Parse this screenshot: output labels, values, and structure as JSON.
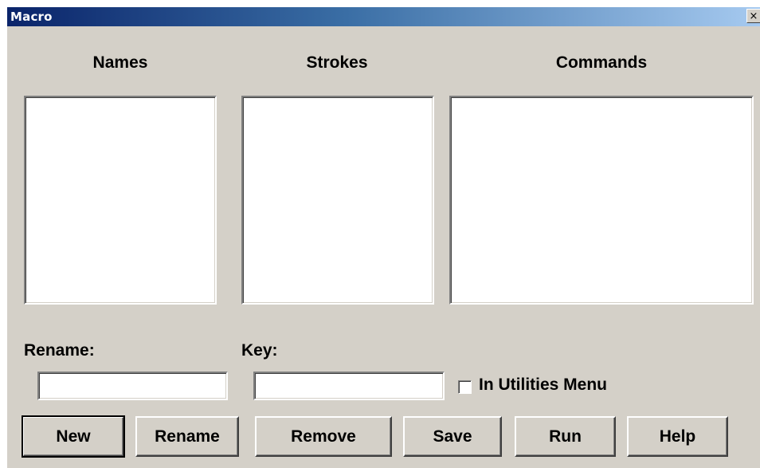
{
  "window": {
    "title": "Macro",
    "close_glyph": "×"
  },
  "columns": {
    "names_label": "Names",
    "strokes_label": "Strokes",
    "commands_label": "Commands"
  },
  "form": {
    "rename_label": "Rename:",
    "rename_value": "",
    "key_label": "Key:",
    "key_value": "",
    "utilities_menu_label": "In Utilities Menu",
    "utilities_menu_checked": false
  },
  "buttons": {
    "new": "New",
    "rename": "Rename",
    "remove": "Remove",
    "save": "Save",
    "run": "Run",
    "help": "Help"
  }
}
